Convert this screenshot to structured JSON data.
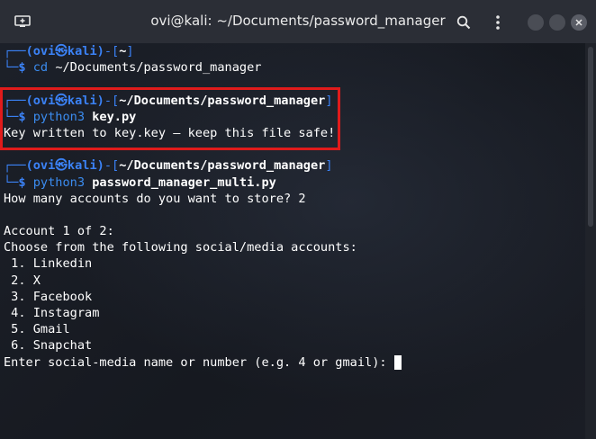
{
  "window": {
    "title": "ovi@kali: ~/Documents/password_manager"
  },
  "terminal": {
    "block1": {
      "prompt_user": "(ovi㉿kali)",
      "prompt_dir": "~",
      "command_name": "cd",
      "command_args": "~/Documents/password_manager"
    },
    "block2": {
      "prompt_user": "(ovi㉿kali)",
      "prompt_dir": "~/Documents/password_manager",
      "command_name": "python3",
      "command_args": "key.py",
      "output": "Key written to key.key — keep this file safe!"
    },
    "block3": {
      "prompt_user": "(ovi㉿kali)",
      "prompt_dir": "~/Documents/password_manager",
      "command_name": "python3",
      "command_args": "password_manager_multi.py",
      "output": [
        "How many accounts do you want to store? 2",
        "",
        "Account 1 of 2:",
        "Choose from the following social/media accounts:",
        " 1. Linkedin",
        " 2. X",
        " 3. Facebook",
        " 4. Instagram",
        " 5. Gmail",
        " 6. Snapchat"
      ],
      "input_prompt": "Enter social-media name or number (e.g. 4 or gmail): "
    }
  },
  "colors": {
    "highlight_border": "#e01b1b",
    "prompt_blue": "#3b82f6"
  }
}
